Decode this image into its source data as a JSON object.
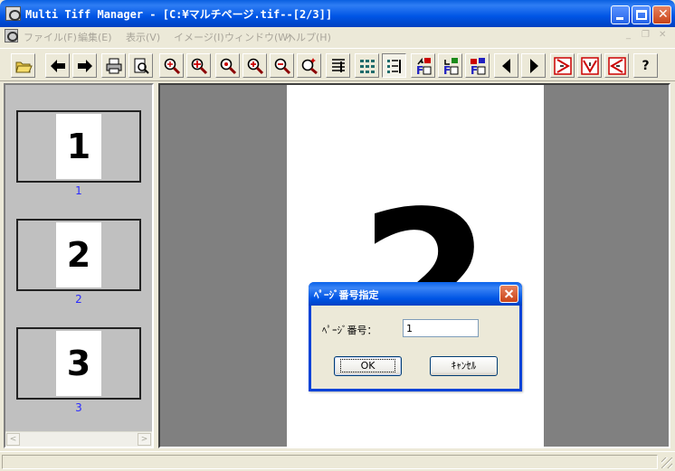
{
  "window": {
    "title": "Multi Tiff Manager - [C:¥マルチページ.tif--[2/3]]"
  },
  "menu": {
    "items": [
      "ファイル(F)",
      "編集(E)",
      "表示(V)",
      "イメージ(I)",
      "ウィンドウ(W)",
      "ヘルプ(H)"
    ]
  },
  "toolbar": {
    "tools": [
      "open-icon",
      "back-arrow-icon",
      "forward-arrow-icon",
      "print-icon",
      "print-preview-icon",
      "zoom-fit-icon",
      "zoom-in-plus-icon",
      "zoom-out-icon",
      "zoom-in-icon",
      "zoom-out-small-icon",
      "zoom-star-icon",
      "single-page-view-icon",
      "thumbnail-grid-icon",
      "list-view-icon",
      "insert-page-before-icon",
      "insert-page-after-icon",
      "delete-page-icon",
      "previous-page-icon",
      "next-page-icon",
      "rotate-right-icon",
      "flip-vertical-icon",
      "rotate-left-icon",
      "help-icon"
    ],
    "help_glyph": "?"
  },
  "thumbnails": [
    {
      "digit": "1",
      "label": "1"
    },
    {
      "digit": "2",
      "label": "2"
    },
    {
      "digit": "3",
      "label": "3"
    }
  ],
  "scroll": {
    "left_arrow": "<",
    "right_arrow": ">"
  },
  "main": {
    "page_digit": "2"
  },
  "dialog": {
    "title": "ﾍﾟｰｼﾞ番号指定",
    "field_label": "ﾍﾟｰｼﾞ番号：",
    "field_value": "1",
    "ok_label": "OK",
    "cancel_label": "ｷｬﾝｾﾙ"
  },
  "colors": {
    "titlebar": "#0055e5",
    "thumb_label": "#2a2aff",
    "viewer_background": "#808080",
    "close_button": "#c94418"
  }
}
